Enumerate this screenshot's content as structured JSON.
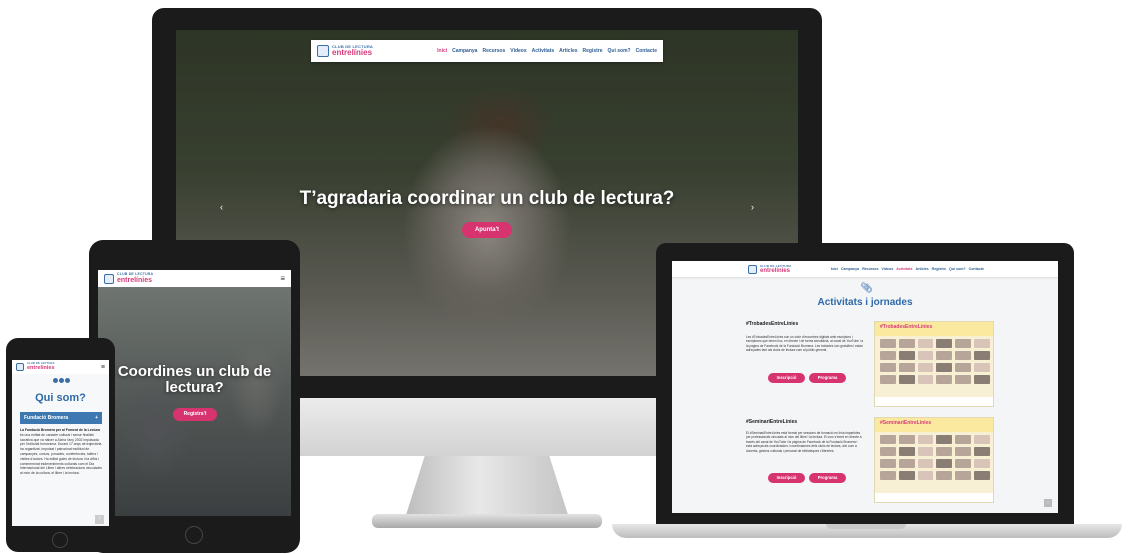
{
  "site": {
    "logo_top": "CLUB DE LECTURA",
    "logo_bottom": "entrelínies",
    "nav": [
      "Inici",
      "Campanya",
      "Recursos",
      "Vídeos",
      "Activitats",
      "Articles",
      "Registre",
      "Qui som?",
      "Contacte"
    ]
  },
  "desktop": {
    "hero_title": "T’agradaria coordinar un club de lectura?",
    "hero_button": "Apunta't",
    "prev_arrow": "‹",
    "next_arrow": "›"
  },
  "tablet": {
    "hero_title": "Coordines un club de lectura?",
    "hero_button": "Registra't",
    "menu_icon": "≡"
  },
  "phone": {
    "menu_icon": "≡",
    "section_title": "Qui som?",
    "accordion_label": "Fundació Bromera",
    "accordion_icon": "+",
    "body_lead": "La Fundació Bromera per al Foment de la Lectura",
    "body_text": " és una entitat de caràcter cultural i sense finalitat lucrativa que va nàixer a Alzira l’any 2002 impulsada per l’editorial homònima. Durant 17 anys de trajectòria ha organitzat, impulsat i patrocinat multitud de campanyes, cursos, jornades, conferències, tallers i visites d’autors. Ha editat guies de lectura i ha difós i commemorat esdeveniments culturals com el Dia Internacional del Llibre i altres celebracions vinculades al món de la cultura, el llibre i la lectura.",
    "scroll_top": "↑"
  },
  "laptop": {
    "page_title": "Activitats i jornades",
    "sections": [
      {
        "title": "#TrobadesEntreLínies",
        "text": "Les #TrobadesEntreLínies són un cicle d’encontres digitals amb escriptors i escriptores que tenen lloc, en directe i de forma simultània, al canal de YouTube i a la pàgina de Facebook de la Fundació Bromera. Les trobades són gratuïtes i estan adreçades tant als clubs de lectura com al públic general.",
        "poster_title": "#TrobadesEntreLínies",
        "btn_register": "Inscripció",
        "btn_program": "Programa"
      },
      {
        "title": "#SeminariEntreLínies",
        "text": "El #SeminariEntreLínies està format per sessions de formació en línia impartides per professionals vinculats al món del llibre i la lectura. El curs s’emet en directe a través del canal de YouTube i la pàgina de Facebook de la Fundació Bromera i està adreçat als coordinadors i coordinadores dels clubs de lectura, així com a docents, gestors culturals i personal de biblioteques i llibreries.",
        "poster_title": "#SeminariEntreLínies",
        "btn_register": "Inscripció",
        "btn_program": "Programa"
      }
    ],
    "scroll_top": "↑"
  },
  "colors": {
    "accent_pink": "#d6336f",
    "brand_blue": "#2e6aa8",
    "bezel": "#1b1b1c"
  }
}
